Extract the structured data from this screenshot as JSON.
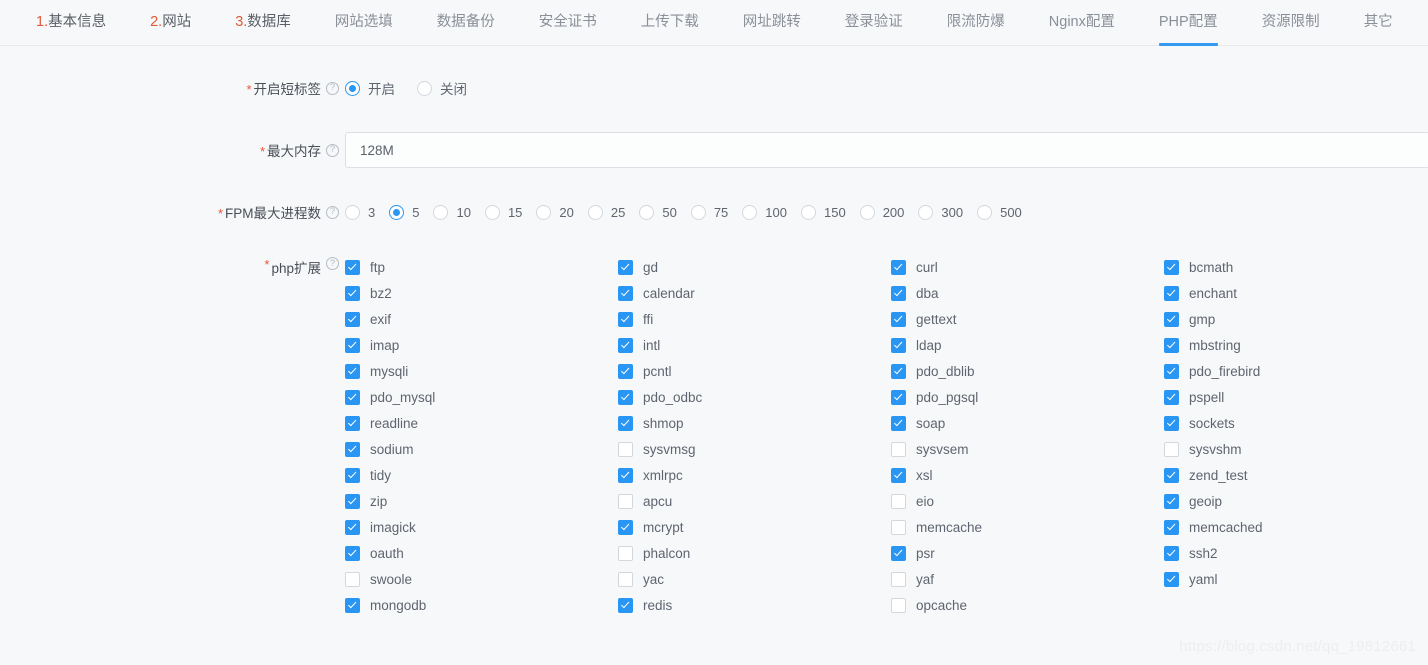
{
  "tabs": [
    {
      "num": "1.",
      "label": "基本信息",
      "active": false
    },
    {
      "num": "2.",
      "label": "网站",
      "active": false
    },
    {
      "num": "3.",
      "label": "数据库",
      "active": false
    },
    {
      "num": "",
      "label": "网站选填",
      "active": false
    },
    {
      "num": "",
      "label": "数据备份",
      "active": false
    },
    {
      "num": "",
      "label": "安全证书",
      "active": false
    },
    {
      "num": "",
      "label": "上传下载",
      "active": false
    },
    {
      "num": "",
      "label": "网址跳转",
      "active": false
    },
    {
      "num": "",
      "label": "登录验证",
      "active": false
    },
    {
      "num": "",
      "label": "限流防爆",
      "active": false
    },
    {
      "num": "",
      "label": "Nginx配置",
      "active": false
    },
    {
      "num": "",
      "label": "PHP配置",
      "active": true
    },
    {
      "num": "",
      "label": "资源限制",
      "active": false
    },
    {
      "num": "",
      "label": "其它",
      "active": false
    }
  ],
  "form": {
    "short_tag": {
      "label": "开启短标签",
      "required_mark": "*",
      "help_glyph": "?",
      "options": [
        {
          "label": "开启",
          "selected": true
        },
        {
          "label": "关闭",
          "selected": false
        }
      ]
    },
    "max_memory": {
      "label": "最大内存",
      "required_mark": "*",
      "help_glyph": "?",
      "value": "128M",
      "placeholder": "128M"
    },
    "fpm_max_process": {
      "label": "FPM最大进程数",
      "required_mark": "*",
      "help_glyph": "?",
      "options": [
        {
          "label": "3",
          "selected": false
        },
        {
          "label": "5",
          "selected": true
        },
        {
          "label": "10",
          "selected": false
        },
        {
          "label": "15",
          "selected": false
        },
        {
          "label": "20",
          "selected": false
        },
        {
          "label": "25",
          "selected": false
        },
        {
          "label": "50",
          "selected": false
        },
        {
          "label": "75",
          "selected": false
        },
        {
          "label": "100",
          "selected": false
        },
        {
          "label": "150",
          "selected": false
        },
        {
          "label": "200",
          "selected": false
        },
        {
          "label": "300",
          "selected": false
        },
        {
          "label": "500",
          "selected": false
        }
      ]
    },
    "php_extensions": {
      "label": "php扩展",
      "required_mark": "*",
      "help_glyph": "?",
      "columns": [
        [
          {
            "label": "ftp",
            "checked": true
          },
          {
            "label": "bz2",
            "checked": true
          },
          {
            "label": "exif",
            "checked": true
          },
          {
            "label": "imap",
            "checked": true
          },
          {
            "label": "mysqli",
            "checked": true
          },
          {
            "label": "pdo_mysql",
            "checked": true
          },
          {
            "label": "readline",
            "checked": true
          },
          {
            "label": "sodium",
            "checked": true
          },
          {
            "label": "tidy",
            "checked": true
          },
          {
            "label": "zip",
            "checked": true
          },
          {
            "label": "imagick",
            "checked": true
          },
          {
            "label": "oauth",
            "checked": true
          },
          {
            "label": "swoole",
            "checked": false
          },
          {
            "label": "mongodb",
            "checked": true
          }
        ],
        [
          {
            "label": "gd",
            "checked": true
          },
          {
            "label": "calendar",
            "checked": true
          },
          {
            "label": "ffi",
            "checked": true
          },
          {
            "label": "intl",
            "checked": true
          },
          {
            "label": "pcntl",
            "checked": true
          },
          {
            "label": "pdo_odbc",
            "checked": true
          },
          {
            "label": "shmop",
            "checked": true
          },
          {
            "label": "sysvmsg",
            "checked": false
          },
          {
            "label": "xmlrpc",
            "checked": true
          },
          {
            "label": "apcu",
            "checked": false
          },
          {
            "label": "mcrypt",
            "checked": true
          },
          {
            "label": "phalcon",
            "checked": false
          },
          {
            "label": "yac",
            "checked": false
          },
          {
            "label": "redis",
            "checked": true
          }
        ],
        [
          {
            "label": "curl",
            "checked": true
          },
          {
            "label": "dba",
            "checked": true
          },
          {
            "label": "gettext",
            "checked": true
          },
          {
            "label": "ldap",
            "checked": true
          },
          {
            "label": "pdo_dblib",
            "checked": true
          },
          {
            "label": "pdo_pgsql",
            "checked": true
          },
          {
            "label": "soap",
            "checked": true
          },
          {
            "label": "sysvsem",
            "checked": false
          },
          {
            "label": "xsl",
            "checked": true
          },
          {
            "label": "eio",
            "checked": false
          },
          {
            "label": "memcache",
            "checked": false
          },
          {
            "label": "psr",
            "checked": true
          },
          {
            "label": "yaf",
            "checked": false
          },
          {
            "label": "opcache",
            "checked": false
          }
        ],
        [
          {
            "label": "bcmath",
            "checked": true
          },
          {
            "label": "enchant",
            "checked": true
          },
          {
            "label": "gmp",
            "checked": true
          },
          {
            "label": "mbstring",
            "checked": true
          },
          {
            "label": "pdo_firebird",
            "checked": true
          },
          {
            "label": "pspell",
            "checked": true
          },
          {
            "label": "sockets",
            "checked": true
          },
          {
            "label": "sysvshm",
            "checked": false
          },
          {
            "label": "zend_test",
            "checked": true
          },
          {
            "label": "geoip",
            "checked": true
          },
          {
            "label": "memcached",
            "checked": true
          },
          {
            "label": "ssh2",
            "checked": true
          },
          {
            "label": "yaml",
            "checked": true
          }
        ]
      ]
    }
  },
  "watermark": "https://blog.csdn.net/qq_19812661",
  "colors": {
    "accent": "#2a96f3",
    "tab_active_underline": "#3499f0",
    "required_mark": "#f0503a",
    "tab_number": "#e05a3a",
    "background": "#f7f8f9"
  }
}
